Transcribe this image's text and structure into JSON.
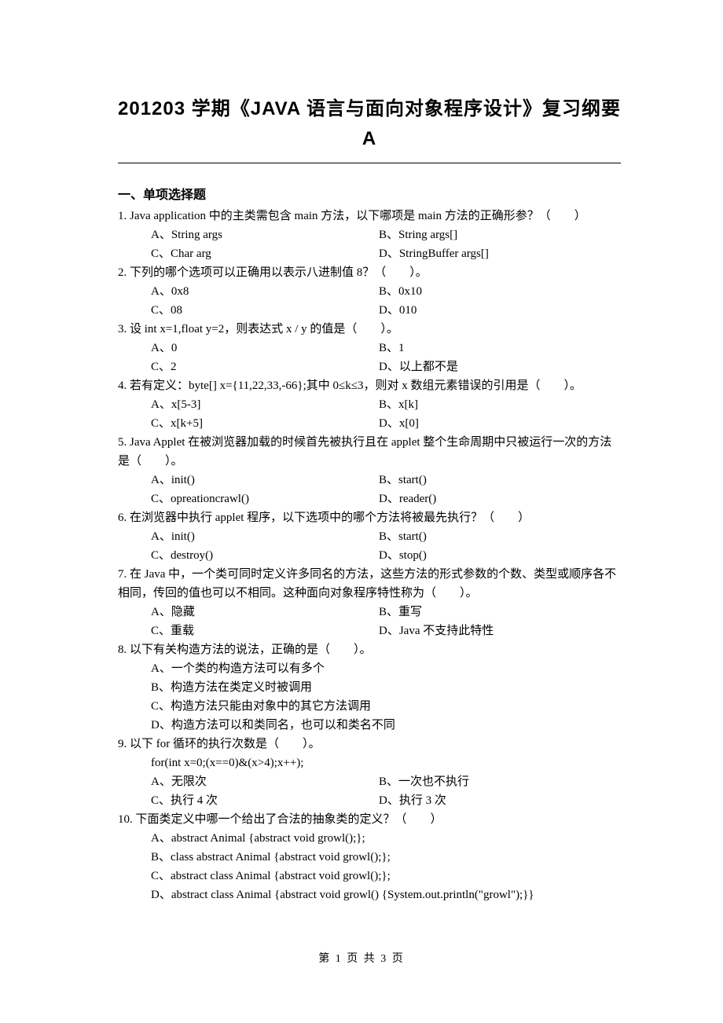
{
  "title": "201203 学期《JAVA 语言与面向对象程序设计》复习纲要 A",
  "section1": "一、单项选择题",
  "q1": {
    "text": "1.  Java application 中的主类需包含 main 方法，以下哪项是 main 方法的正确形参？（　　）",
    "a": "A、String args",
    "b": "B、String args[]",
    "c": "C、Char arg",
    "d": "D、StringBuffer args[]"
  },
  "q2": {
    "text": "2. 下列的哪个选项可以正确用以表示八进制值 8？（　　）。",
    "a": "A、0x8",
    "b": "B、0x10",
    "c": "C、08",
    "d": "D、010"
  },
  "q3": {
    "text": "3. 设 int x=1,float y=2，则表达式 x / y 的值是（　　）。",
    "a": "A、0",
    "b": "B、1",
    "c": "C、2",
    "d": "D、以上都不是"
  },
  "q4": {
    "text": "4. 若有定义：byte[] x={11,22,33,-66};其中 0≤k≤3，则对 x 数组元素错误的引用是（　　）。",
    "a": "A、x[5-3]",
    "b": "B、x[k]",
    "c": "C、x[k+5]",
    "d": "D、x[0]"
  },
  "q5": {
    "text": "5. Java Applet 在被浏览器加载的时候首先被执行且在 applet 整个生命周期中只被运行一次的方法是（　　）。",
    "a": "A、init()",
    "b": "B、start()",
    "c": "C、opreationcrawl()",
    "d": "D、reader()"
  },
  "q6": {
    "text": "6. 在浏览器中执行 applet 程序，以下选项中的哪个方法将被最先执行？（　　）",
    "a": "A、init()",
    "b": "B、start()",
    "c": "C、destroy()",
    "d": "D、stop()"
  },
  "q7": {
    "text": "7. 在 Java 中，一个类可同时定义许多同名的方法，这些方法的形式参数的个数、类型或顺序各不相同，传回的值也可以不相同。这种面向对象程序特性称为（　　）。",
    "a": "A、隐藏",
    "b": "B、重写",
    "c": "C、重载",
    "d": "D、Java 不支持此特性"
  },
  "q8": {
    "text": "8. 以下有关构造方法的说法，正确的是（　　）。",
    "a": "A、一个类的构造方法可以有多个",
    "b": "B、构造方法在类定义时被调用",
    "c": "C、构造方法只能由对象中的其它方法调用",
    "d": "D、构造方法可以和类同名，也可以和类名不同"
  },
  "q9": {
    "text": "9. 以下 for 循环的执行次数是（　　）。",
    "code": "for(int x=0;(x==0)&(x>4);x++);",
    "a": "A、无限次",
    "b": "B、一次也不执行",
    "c": "C、执行 4 次",
    "d": "D、执行 3 次"
  },
  "q10": {
    "text": "10. 下面类定义中哪一个给出了合法的抽象类的定义？（　　）",
    "a": "A、abstract Animal {abstract void growl();};",
    "b": "B、class abstract Animal {abstract void growl();};",
    "c": "C、abstract class Animal {abstract void growl();};",
    "d": "D、abstract class Animal {abstract void growl() {System.out.println(\"growl\");}}"
  },
  "footer": "第 1 页 共 3 页"
}
